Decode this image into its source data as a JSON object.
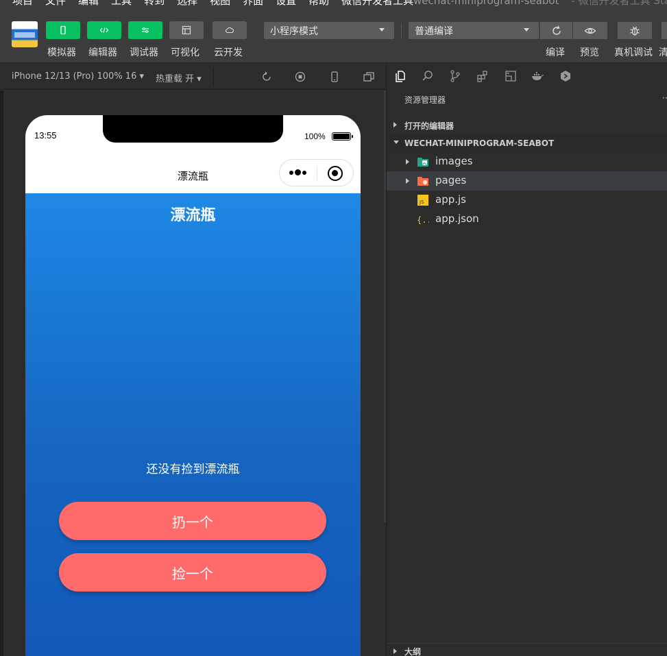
{
  "menubar": {
    "items": [
      "项目",
      "文件",
      "编辑",
      "工具",
      "转到",
      "选择",
      "视图",
      "界面",
      "设置",
      "帮助",
      "微信开发者工具"
    ],
    "window_title": "wechat-miniprogram-seabot",
    "window_suffix": "- 微信开发者工具 Stable"
  },
  "toolbar": {
    "simulator_label": "模拟器",
    "editor_label": "编辑器",
    "debugger_label": "调试器",
    "visual_label": "可视化",
    "cloud_label": "云开发",
    "mode_select": "小程序模式",
    "compile_select": "普通编译",
    "compile_label": "编译",
    "preview_label": "预览",
    "real_debug_label": "真机调试",
    "clear_cache_label": "清"
  },
  "simbar": {
    "device": "iPhone 12/13 (Pro) 100% 16 ▾",
    "hot_reload": "热重载 开 ▾"
  },
  "phone": {
    "time": "13:55",
    "battery": "100%",
    "nav_title": "漂流瓶",
    "page_heading": "漂流瓶",
    "empty_text": "还没有捡到漂流瓶",
    "throw_button": "扔一个",
    "pick_button": "捡一个"
  },
  "explorer": {
    "title": "资源管理器",
    "more": "···",
    "open_editors": "打开的编辑器",
    "project": "WECHAT-MINIPROGRAM-SEABOT",
    "items": [
      {
        "name": "images",
        "type": "folder"
      },
      {
        "name": "pages",
        "type": "folder"
      },
      {
        "name": "app.js",
        "type": "js"
      },
      {
        "name": "app.json",
        "type": "json"
      }
    ],
    "outline": "大纲"
  },
  "colors": {
    "accent_green": "#07c160",
    "button_red": "#ff6b6b",
    "page_blue_top": "#1e88e5",
    "page_blue_bottom": "#1357b8"
  }
}
